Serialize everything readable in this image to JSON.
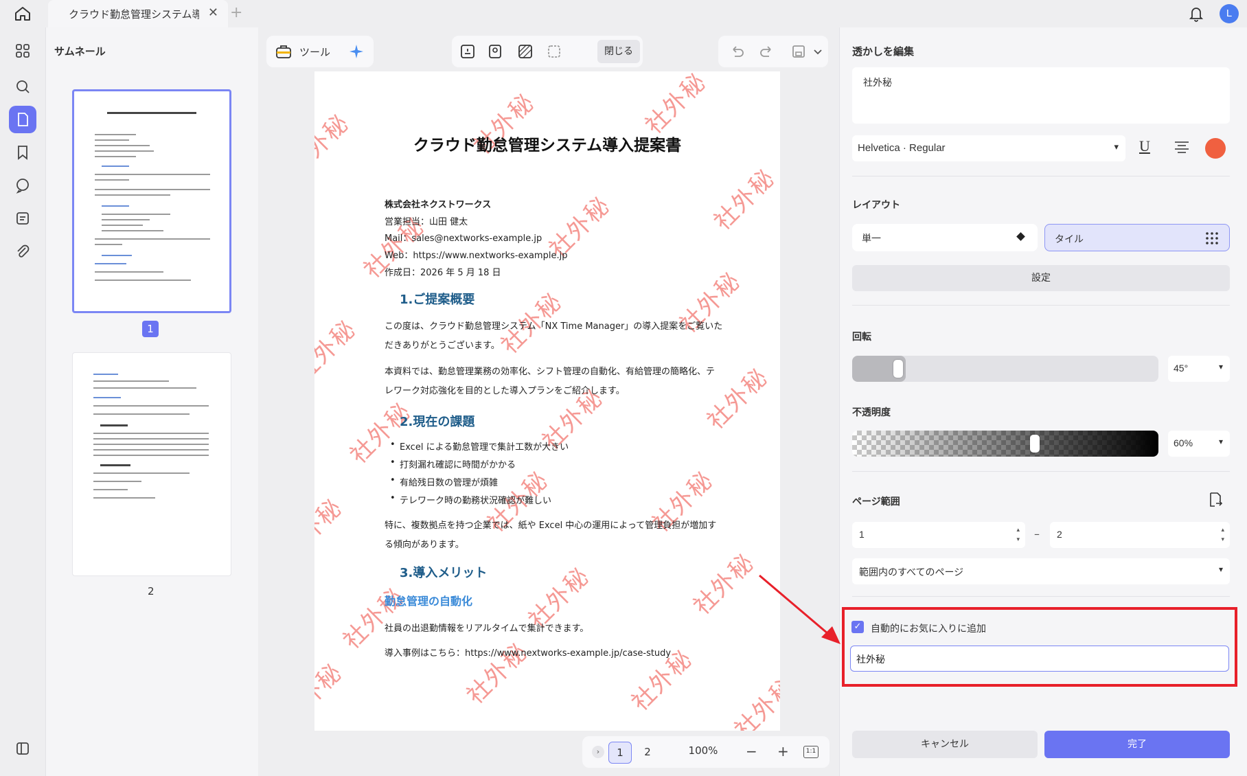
{
  "tab": {
    "title": "クラウド勤怠管理システム導入",
    "close": "✕",
    "add": "+"
  },
  "user": {
    "avatar_letter": "L"
  },
  "thumbnails": {
    "title": "サムネール",
    "page1": "1",
    "page2": "2"
  },
  "toolbar": {
    "tools_label": "ツール",
    "close_label": "閉じる"
  },
  "document": {
    "title": "クラウド勤怠管理システム導入提案書",
    "company": "株式会社ネクストワークス",
    "rep": "営業担当：山田 健太",
    "mail": "Mail：sales@nextworks-example.jp",
    "web": "Web：https://www.nextworks-example.jp",
    "date": "作成日：2026 年 5 月 18 日",
    "s1_title": "1.ご提案概要",
    "s1_p1a": "この度は、クラウド勤怠管理システム「NX Time Manager」の導入提案をご覧いた",
    "s1_p1b": "だきありがとうございます。",
    "s1_p2a": "本資料では、勤怠管理業務の効率化、シフト管理の自動化、有給管理の簡略化、テ",
    "s1_p2b": "レワーク対応強化を目的とした導入プランをご紹介します。",
    "s2_title": "2.現在の課題",
    "bullets": [
      "Excel による勤怠管理で集計工数が大きい",
      "打刻漏れ確認に時間がかかる",
      "有給残日数の管理が煩雑",
      "テレワーク時の勤務状況確認が難しい"
    ],
    "s2_pa": "特に、複数拠点を持つ企業では、紙や Excel 中心の運用によって管理負担が増加す",
    "s2_pb": "る傾向があります。",
    "s3_title": "3.導入メリット",
    "s3_sub": "勤怠管理の自動化",
    "s3_p1": "社員の出退勤情報をリアルタイムで集計できます。",
    "s3_p2": "導入事例はこちら：https://www.nextworks-example.jp/case-study",
    "watermark": "社外秘"
  },
  "pager": {
    "page1": "1",
    "page2": "2",
    "zoom": "100%",
    "minus": "−",
    "plus": "+",
    "fit": "1:1",
    "expand": "›"
  },
  "panel": {
    "title": "透かしを編集",
    "watermark_text": "社外秘",
    "font": "Helvetica · Regular",
    "underline": "U",
    "color": "#f06040",
    "layout_label": "レイアウト",
    "single": "単一",
    "tile": "タイル",
    "settings": "設定",
    "rotation_label": "回転",
    "rotation_value": "45°",
    "rotation_fraction": 0.125,
    "opacity_label": "不透明度",
    "opacity_value": "60%",
    "opacity_fraction": 0.6,
    "page_range_label": "ページ範囲",
    "from": "1",
    "to": "2",
    "range_option": "範囲内のすべてのページ",
    "auto_fav_label": "自動的にお気に入りに追加",
    "checkmark": "✓",
    "fav_input_value": "社外秘",
    "cancel": "キャンセル",
    "done": "完了"
  }
}
